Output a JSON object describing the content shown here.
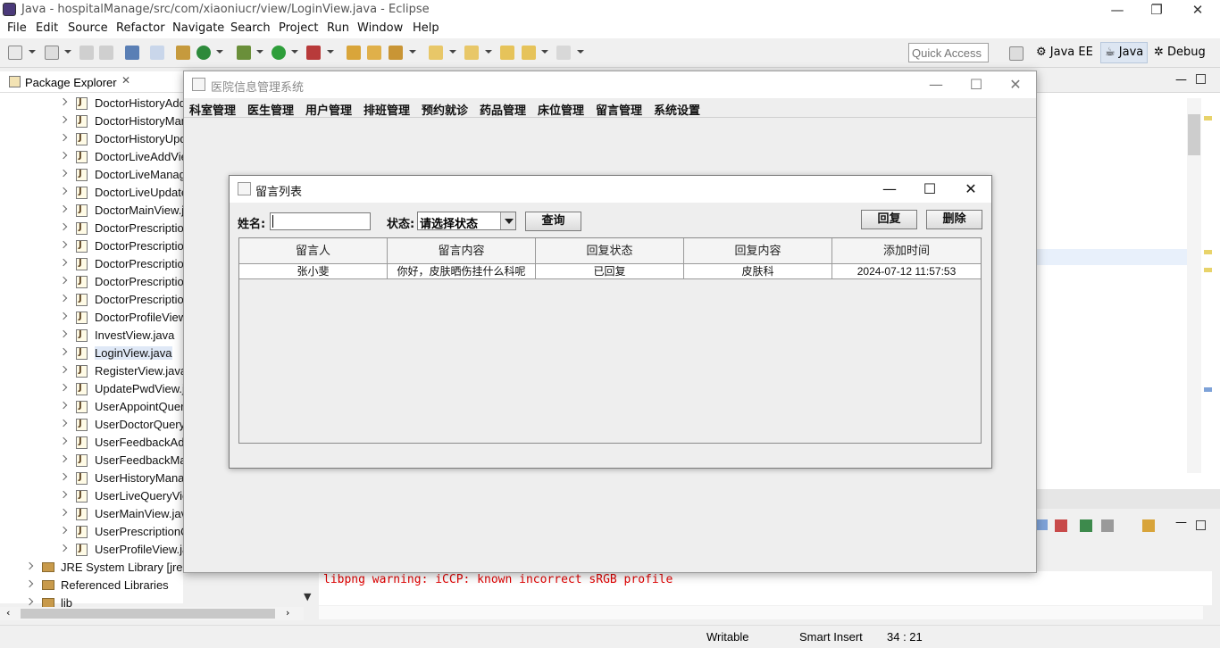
{
  "window": {
    "title": "Java - hospitalManage/src/com/xiaoniucr/view/LoginView.java - Eclipse"
  },
  "menu": [
    "File",
    "Edit",
    "Source",
    "Refactor",
    "Navigate",
    "Search",
    "Project",
    "Run",
    "Window",
    "Help"
  ],
  "toolbar": {
    "quick_access_placeholder": "Quick Access"
  },
  "perspectives": [
    "Java EE",
    "Java",
    "Debug"
  ],
  "package_explorer": {
    "title": "Package Explorer",
    "files": [
      "DoctorHistoryAddView.java",
      "DoctorHistoryManageView.java",
      "DoctorHistoryUpdateView.java",
      "DoctorLiveAddView.java",
      "DoctorLiveManageView.java",
      "DoctorLiveUpdateView.java",
      "DoctorMainView.java",
      "DoctorPrescriptionAddView.java",
      "DoctorPrescriptionDetailView.java",
      "DoctorPrescriptionManageView.java",
      "DoctorPrescriptionQueryView.java",
      "DoctorPrescriptionUpdateView.java",
      "DoctorProfileView.java",
      "InvestView.java",
      "LoginView.java",
      "RegisterView.java",
      "UpdatePwdView.java",
      "UserAppointQueryView.java",
      "UserDoctorQueryView.java",
      "UserFeedbackAddView.java",
      "UserFeedbackManageView.java",
      "UserHistoryManageView.java",
      "UserLiveQueryView.java",
      "UserMainView.java",
      "UserPrescriptionQueryView.java",
      "UserProfileView.java"
    ],
    "selected": "LoginView.java",
    "libraries": [
      "JRE System Library [jre1.8]",
      "Referenced Libraries",
      "lib"
    ]
  },
  "console": {
    "warning": "libpng warning: iCCP: known incorrect sRGB profile"
  },
  "statusbar": {
    "mode": "Writable",
    "insert": "Smart Insert",
    "position": "34 : 21"
  },
  "app": {
    "title": "医院信息管理系统",
    "menu": [
      "科室管理",
      "医生管理",
      "用户管理",
      "排班管理",
      "预约就诊",
      "药品管理",
      "床位管理",
      "留言管理",
      "系统设置"
    ]
  },
  "dialog": {
    "title": "留言列表",
    "name_label": "姓名:",
    "name_value": "",
    "status_label": "状态:",
    "status_value": "请选择状态",
    "query_button": "查询",
    "reply_button": "回复",
    "delete_button": "删除",
    "columns": [
      "留言人",
      "留言内容",
      "回复状态",
      "回复内容",
      "添加时间"
    ],
    "rows": [
      [
        "张小斐",
        "你好，皮肤晒伤挂什么科呢",
        "已回复",
        "皮肤科",
        "2024-07-12 11:57:53"
      ]
    ]
  }
}
